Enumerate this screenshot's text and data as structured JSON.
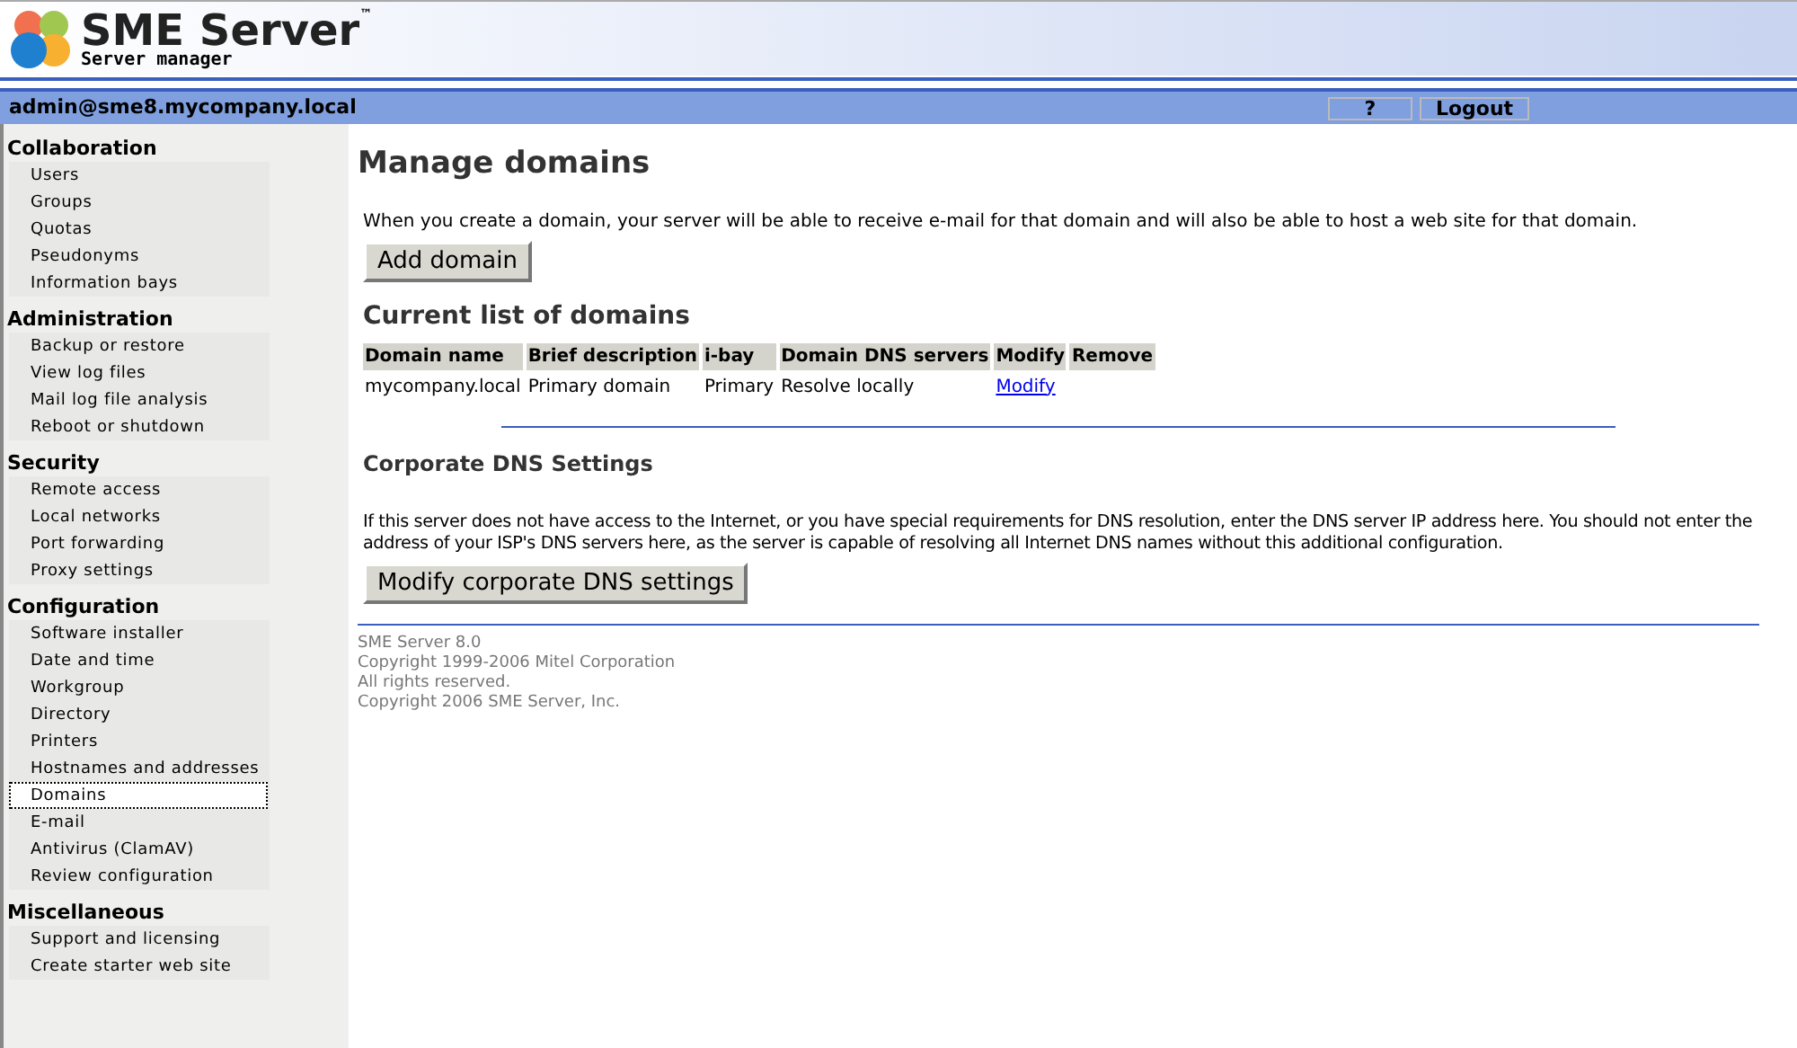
{
  "header": {
    "title": "SME Server",
    "trademark": "™",
    "subtitle": "Server manager"
  },
  "user_bar": {
    "user": "admin@sme8.mycompany.local",
    "buttons": [
      "?",
      "Logout"
    ]
  },
  "sidebar": [
    {
      "heading": "Collaboration",
      "items": [
        {
          "label": "Users",
          "selected": false
        },
        {
          "label": "Groups",
          "selected": false
        },
        {
          "label": "Quotas",
          "selected": false
        },
        {
          "label": "Pseudonyms",
          "selected": false
        },
        {
          "label": "Information bays",
          "selected": false
        }
      ]
    },
    {
      "heading": "Administration",
      "items": [
        {
          "label": "Backup or restore",
          "selected": false
        },
        {
          "label": "View log files",
          "selected": false
        },
        {
          "label": "Mail log file analysis",
          "selected": false
        },
        {
          "label": "Reboot or shutdown",
          "selected": false
        }
      ]
    },
    {
      "heading": "Security",
      "items": [
        {
          "label": "Remote access",
          "selected": false
        },
        {
          "label": "Local networks",
          "selected": false
        },
        {
          "label": "Port forwarding",
          "selected": false
        },
        {
          "label": "Proxy settings",
          "selected": false
        }
      ]
    },
    {
      "heading": "Configuration",
      "items": [
        {
          "label": "Software installer",
          "selected": false
        },
        {
          "label": "Date and time",
          "selected": false
        },
        {
          "label": "Workgroup",
          "selected": false
        },
        {
          "label": "Directory",
          "selected": false
        },
        {
          "label": "Printers",
          "selected": false
        },
        {
          "label": "Hostnames and addresses",
          "selected": false
        },
        {
          "label": "Domains",
          "selected": true
        },
        {
          "label": "E-mail",
          "selected": false
        },
        {
          "label": "Antivirus (ClamAV)",
          "selected": false
        },
        {
          "label": "Review configuration",
          "selected": false
        }
      ]
    },
    {
      "heading": "Miscellaneous",
      "items": [
        {
          "label": "Support and licensing",
          "selected": false
        },
        {
          "label": "Create starter web site",
          "selected": false
        }
      ]
    }
  ],
  "main": {
    "title": "Manage domains",
    "intro": "When you create a domain, your server will be able to receive e-mail for that domain and will also be able to host a web site for that domain.",
    "add_button": "Add domain",
    "list_title": "Current list of domains",
    "table": {
      "columns": [
        "Domain name",
        "Brief description",
        "i-bay",
        "Domain DNS servers",
        "Modify",
        "Remove"
      ],
      "rows": [
        {
          "cells": [
            "mycompany.local",
            "Primary domain",
            "Primary",
            "Resolve locally"
          ],
          "modify_link": "Modify"
        }
      ]
    },
    "dns_title": "Corporate DNS Settings",
    "dns_text": "If this server does not have access to the Internet, or you have special requirements for DNS resolution, enter the DNS server IP address here. You should not enter the address of your ISP's DNS servers here, as the server is capable of resolving all Internet DNS names without this additional configuration.",
    "dns_button": "Modify corporate DNS settings"
  },
  "footer": [
    "SME Server 8.0",
    "Copyright 1999-2006 Mitel Corporation",
    "All rights reserved.",
    "Copyright 2006 SME Server, Inc."
  ]
}
